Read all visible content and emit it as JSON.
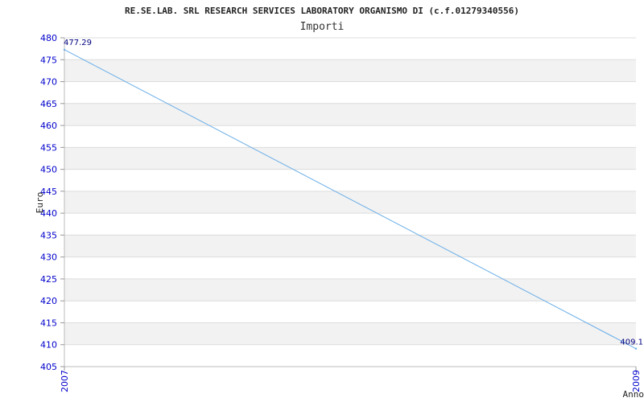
{
  "chart_data": {
    "type": "line",
    "title": "RE.SE.LAB. SRL RESEARCH SERVICES LABORATORY ORGANISMO DI (c.f.01279340556)",
    "subtitle": "Importi",
    "xlabel": "Anno",
    "ylabel": "Euro",
    "categories": [
      "2007",
      "2009"
    ],
    "series": [
      {
        "values": [
          477.29,
          409.1
        ],
        "labels": [
          "477.29",
          "409.1"
        ]
      }
    ],
    "ylim": [
      405,
      480
    ],
    "yticks": [
      "405",
      "410",
      "415",
      "420",
      "425",
      "430",
      "435",
      "440",
      "445",
      "450",
      "455",
      "460",
      "465",
      "470",
      "475",
      "480"
    ],
    "grid": true,
    "line_color": "#6aaee8",
    "tick_color": "#0000cc",
    "label_color": "#000080"
  }
}
